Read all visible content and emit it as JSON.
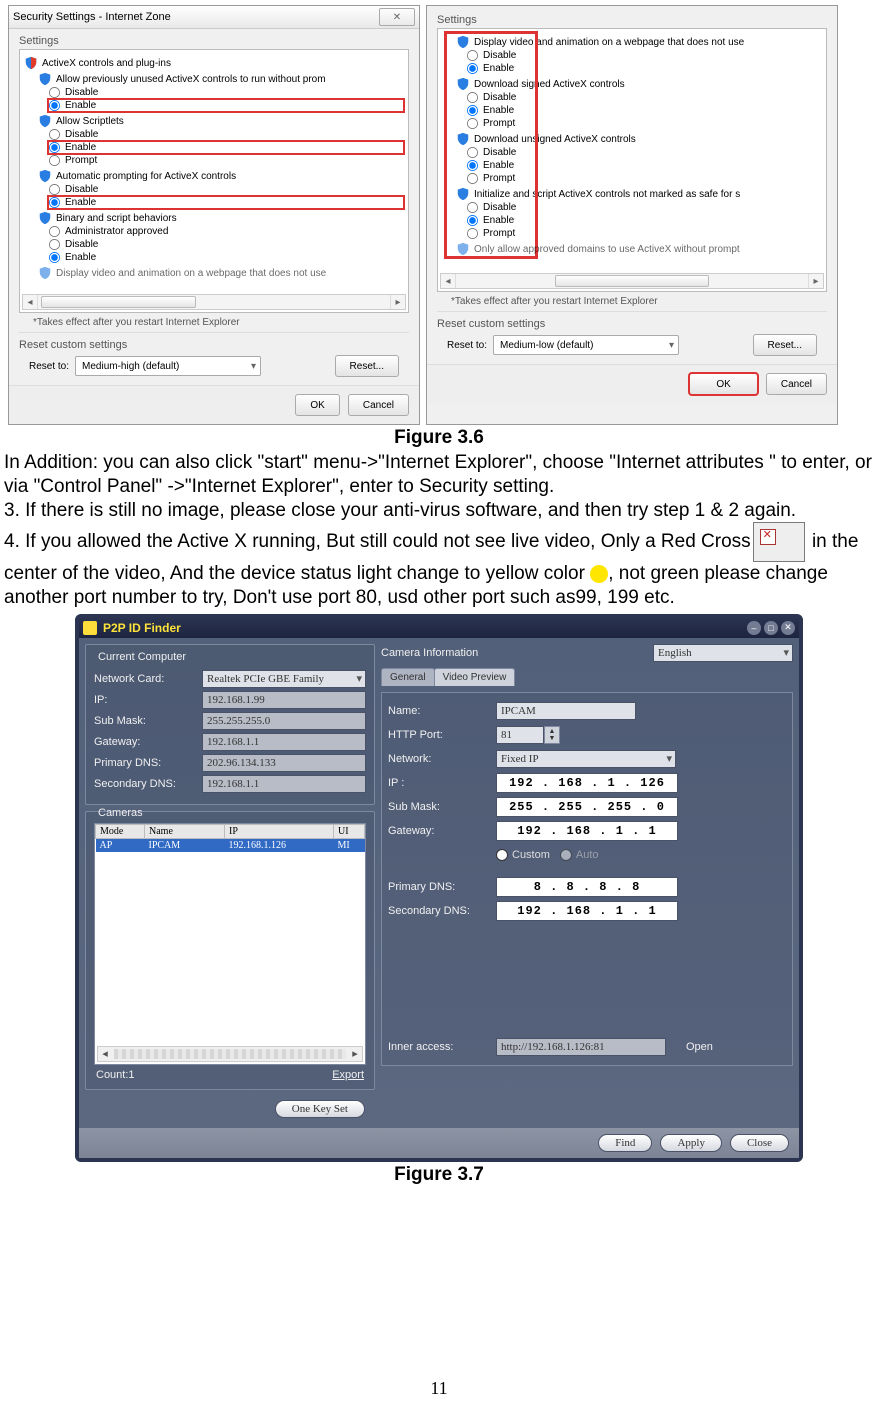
{
  "captions": {
    "fig36": "Figure 3.6",
    "fig37": "Figure 3.7"
  },
  "body": {
    "p1": "In Addition: you can also click \"start\" menu->\"Internet Explorer\", choose \"Internet attributes \" to enter, or via \"Control Panel\" ->\"Internet Explorer\", enter to Security setting.",
    "p2": "3. If there is still no image, please close your anti-virus software, and then try step 1 & 2 again.",
    "p3a": "4. If you allowed the Active X running, But still could not see live video, Only a Red Cross",
    "p3b": " in the center of the video, And the device status light change to yellow color ",
    "p3c": ", not green please change another port number to try, Don't use port 80, usd other port such as99, 199 etc."
  },
  "dlg_left": {
    "title": "Security Settings - Internet Zone",
    "group": "Settings",
    "axHeader": "ActiveX controls and plug-ins",
    "c1": "Allow previously unused ActiveX controls to run without prom",
    "c2": "Allow Scriptlets",
    "c3": "Automatic prompting for ActiveX controls",
    "c4": "Binary and script behaviors",
    "c5cut": "Display video and animation on a webpage that does not use",
    "disable": "Disable",
    "enable": "Enable",
    "prompt": "Prompt",
    "adminApproved": "Administrator approved",
    "note": "*Takes effect after you restart Internet Explorer",
    "resetGroup": "Reset custom settings",
    "resetTo": "Reset to:",
    "resetSel": "Medium-high (default)",
    "resetBtn": "Reset...",
    "ok": "OK",
    "cancel": "Cancel"
  },
  "dlg_right": {
    "group": "Settings",
    "c0": "Display video and animation on a webpage that does not use",
    "c1": "Download signed ActiveX controls",
    "c2": "Download unsigned ActiveX controls",
    "c3": "Initialize and script ActiveX controls not marked as safe for s",
    "c4cut": "Only allow approved domains to use ActiveX without prompt",
    "disable": "Disable",
    "enable": "Enable",
    "prompt": "Prompt",
    "note": "*Takes effect after you restart Internet Explorer",
    "resetGroup": "Reset custom settings",
    "resetTo": "Reset to:",
    "resetSel": "Medium-low (default)",
    "resetBtn": "Reset...",
    "ok": "OK",
    "cancel": "Cancel"
  },
  "p2p": {
    "title": "P2P ID Finder",
    "langSel": "English",
    "left": {
      "group1": "Current Computer",
      "netCardL": "Network Card:",
      "netCard": "Realtek PCIe GBE Family",
      "ipL": "IP:",
      "ip": "192.168.1.99",
      "maskL": "Sub Mask:",
      "mask": "255.255.255.0",
      "gwL": "Gateway:",
      "gw": "192.168.1.1",
      "pdnsL": "Primary DNS:",
      "pdns": "202.96.134.133",
      "sdnsL": "Secondary DNS:",
      "sdns": "192.168.1.1",
      "group2": "Cameras",
      "thMode": "Mode",
      "thName": "Name",
      "thIP": "IP",
      "thUID": "UI",
      "rowMode": "AP",
      "rowName": "IPCAM",
      "rowIP": "192.168.1.126",
      "rowUID": "MI",
      "count": "Count:1",
      "export": "Export"
    },
    "right": {
      "group": "Camera Information",
      "tabGeneral": "General",
      "tabPreview": "Video Preview",
      "nameL": "Name:",
      "name": "IPCAM",
      "portL": "HTTP Port:",
      "port": "81",
      "netL": "Network:",
      "net": "Fixed IP",
      "ipL": "IP :",
      "ip": "192 . 168 .  1  . 126",
      "maskL": "Sub Mask:",
      "mask": "255 . 255 . 255 .  0",
      "gwL": "Gateway:",
      "gw": "192 . 168 .  1  .  1",
      "custom": "Custom",
      "auto": "Auto",
      "pdnsL": "Primary DNS:",
      "pdns": " 8  .  8  .  8  .  8",
      "sdnsL": "Secondary DNS:",
      "sdns": "192 . 168 .  1  .  1",
      "innerL": "Inner access:",
      "inner": "http://192.168.1.126:81",
      "open": "Open",
      "oneKey": "One Key Set",
      "find": "Find",
      "apply": "Apply",
      "close": "Close"
    }
  },
  "pageNumber": "11"
}
